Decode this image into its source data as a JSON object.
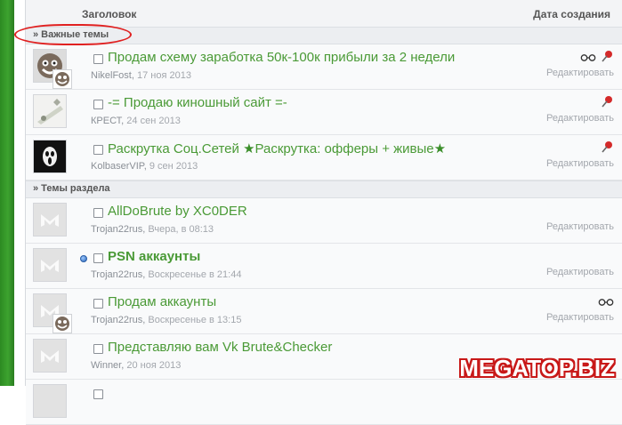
{
  "header": {
    "title_col": "Заголовок",
    "date_col": "Дата создания"
  },
  "sections": {
    "important": "» Важные темы",
    "forum": "» Темы раздела"
  },
  "important_threads": [
    {
      "title": "Продам схему заработка 50к-100к прибыли за 2 недели",
      "author": "NikelFost",
      "date": "17 ноя 2013",
      "edit": "Редактировать",
      "icons": [
        "glasses-icon",
        "pin-icon"
      ]
    },
    {
      "title": "-= Продаю киношный сайт =-",
      "author": "КРЕСТ",
      "date": "24 сен 2013",
      "edit": "Редактировать",
      "icons": [
        "pin-icon"
      ]
    },
    {
      "title_parts": [
        "Раскрутка Соц.Сетей ",
        "★",
        "Раскрутка: офферы + живые",
        "★"
      ],
      "author": "KolbaserVIP",
      "date": "9 сен 2013",
      "edit": "Редактировать",
      "icons": [
        "pin-icon"
      ]
    }
  ],
  "threads": [
    {
      "title": "AllDoBrute by XC0DER",
      "author": "Trojan22rus",
      "date": "Вчера, в 08:13",
      "edit": "Редактировать",
      "unread": false
    },
    {
      "title": "PSN аккаунты",
      "author": "Trojan22rus",
      "date": "Воскресенье в 21:44",
      "edit": "Редактировать",
      "unread": true
    },
    {
      "title": "Продам аккаунты",
      "author": "Trojan22rus",
      "date": "Воскресенье в 13:15",
      "edit": "Редактировать",
      "icons": [
        "glasses-icon"
      ]
    },
    {
      "title": "Представляю вам Vk Brute&Checker",
      "author": "Winner",
      "date": "20 ноя 2013",
      "edit": "Редактировать"
    }
  ],
  "watermark": "MEGATOP.BIZ",
  "colors": {
    "accent_green": "#4a9a36",
    "sidebar_green": "#3da32f",
    "pin_red": "#d42a2a",
    "circle_red": "#e02020"
  }
}
